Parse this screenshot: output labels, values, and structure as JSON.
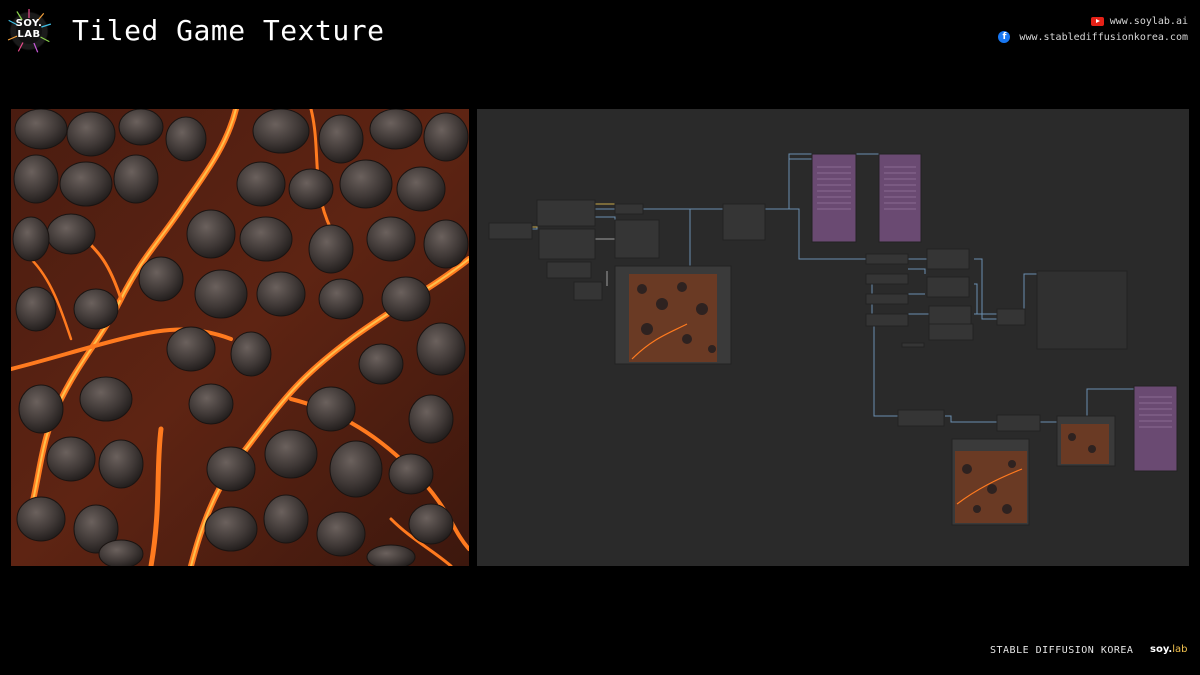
{
  "header": {
    "logo_text_line1": "SOY.",
    "logo_text_line2": "LAB",
    "title": "Tiled Game Texture",
    "links": {
      "youtube": "www.soylab.ai",
      "facebook": "www.stablediffusionkorea.com"
    }
  },
  "icons": {
    "youtube": "youtube-icon",
    "facebook": "facebook-icon",
    "facebook_glyph": "f"
  },
  "colors": {
    "background": "#000000",
    "canvas": "#2a2a2a",
    "node": "#353535",
    "node_header": "#2e2e2e",
    "note_node": "#6a4a72",
    "link": "#6b8fb0",
    "lava": "#f06a1a",
    "rock": "#3d3634"
  },
  "footer": {
    "brand": "STABLE DIFFUSION KOREA",
    "logo_soy": "soy.",
    "logo_lab": "lab"
  }
}
